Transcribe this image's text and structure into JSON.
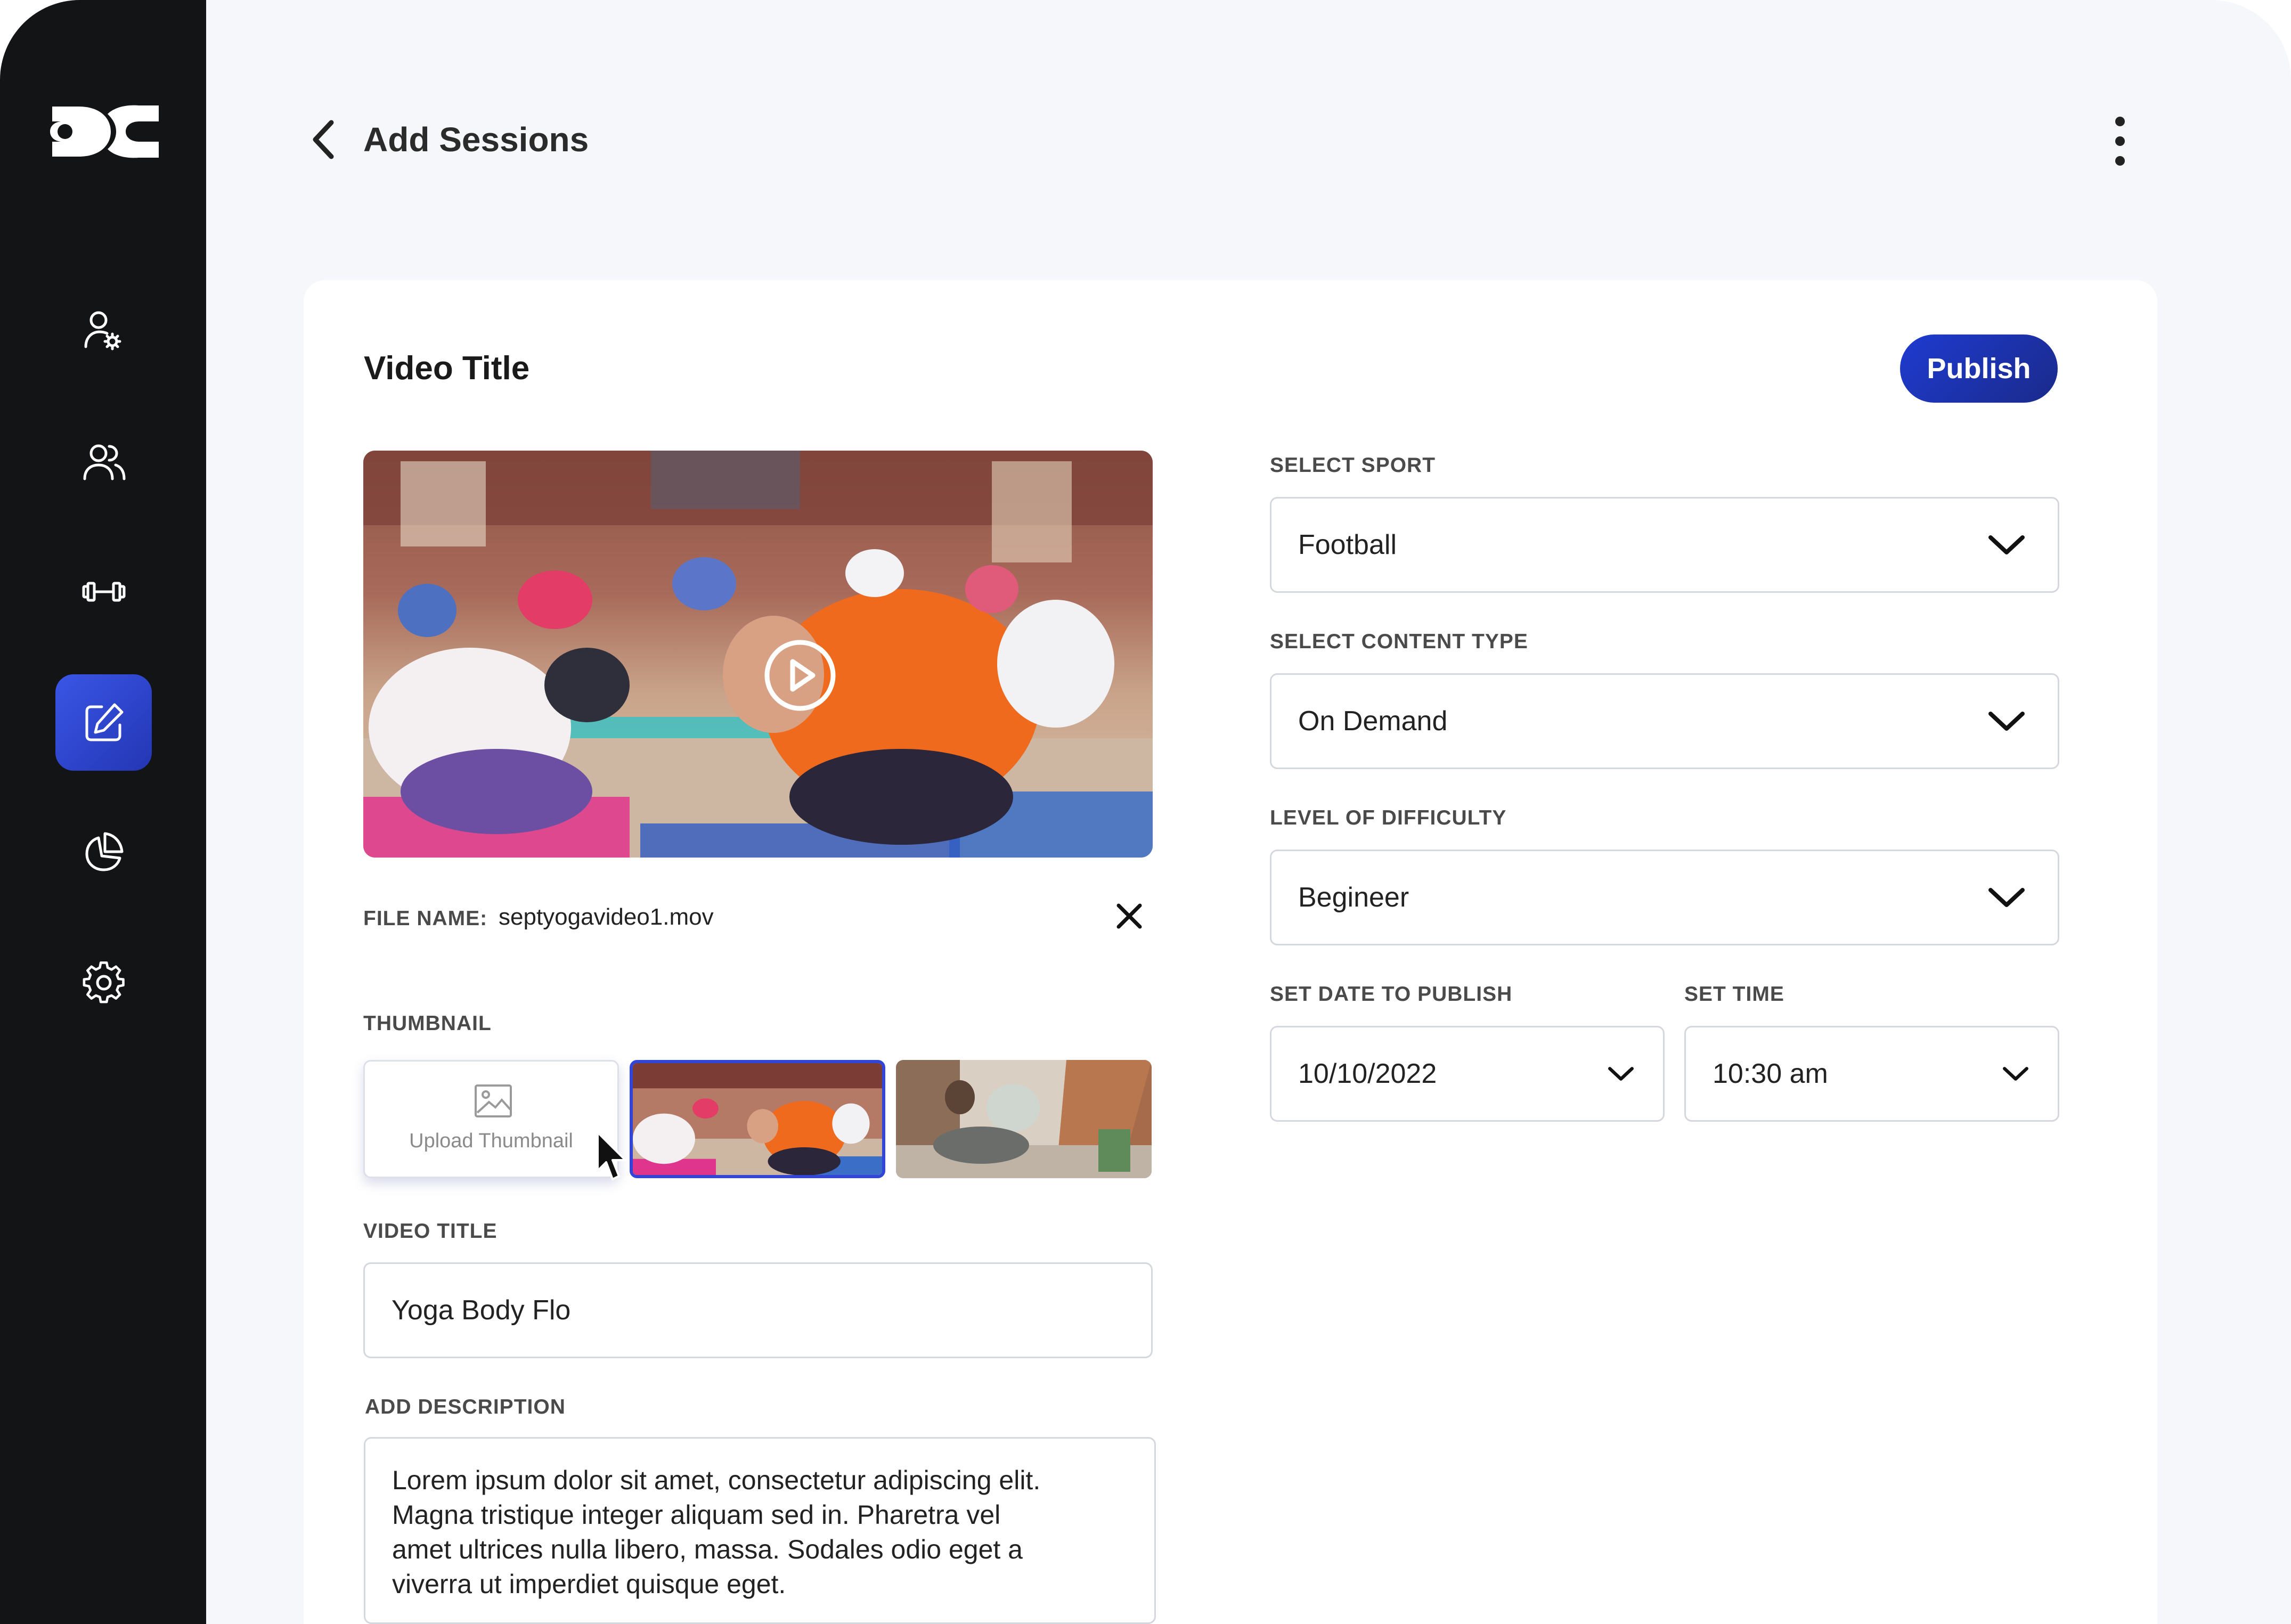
{
  "header": {
    "title": "Add Sessions"
  },
  "sidebar": {
    "items": [
      {
        "icon": "user-settings-icon"
      },
      {
        "icon": "users-icon"
      },
      {
        "icon": "dumbbell-icon"
      },
      {
        "icon": "edit-icon",
        "active": true
      },
      {
        "icon": "pie-chart-icon"
      },
      {
        "icon": "settings-gear-icon"
      }
    ]
  },
  "card": {
    "title": "Video Title",
    "publish_label": "Publish"
  },
  "video": {
    "file_name_label": "FILE NAME:",
    "file_name": "septyogavideo1.mov"
  },
  "thumbnail": {
    "label": "THUMBNAIL",
    "upload_label": "Upload Thumbnail"
  },
  "video_title": {
    "label": "VIDEO TITLE",
    "value": "Yoga Body Flo"
  },
  "description": {
    "label": "ADD DESCRIPTION",
    "line1": "Lorem ipsum dolor sit amet, consectetur adipiscing elit.",
    "line2": "Magna tristique integer aliquam sed in. Pharetra vel",
    "line3": "amet ultrices nulla libero, massa. Sodales odio eget a",
    "line4": "viverra ut imperdiet quisque eget."
  },
  "form": {
    "sport": {
      "label": "SELECT SPORT",
      "value": "Football"
    },
    "content_type": {
      "label": "SELECT CONTENT TYPE",
      "value": "On Demand"
    },
    "difficulty": {
      "label": "LEVEL OF DIFFICULTY",
      "value": "Begineer"
    },
    "date": {
      "label": "SET DATE TO PUBLISH",
      "value": "10/10/2022"
    },
    "time": {
      "label": "SET TIME",
      "value": "10:30 am"
    }
  },
  "colors": {
    "sidebar_bg": "#121416",
    "accent": "#2a44d6",
    "page_bg": "#f5f7fa"
  }
}
